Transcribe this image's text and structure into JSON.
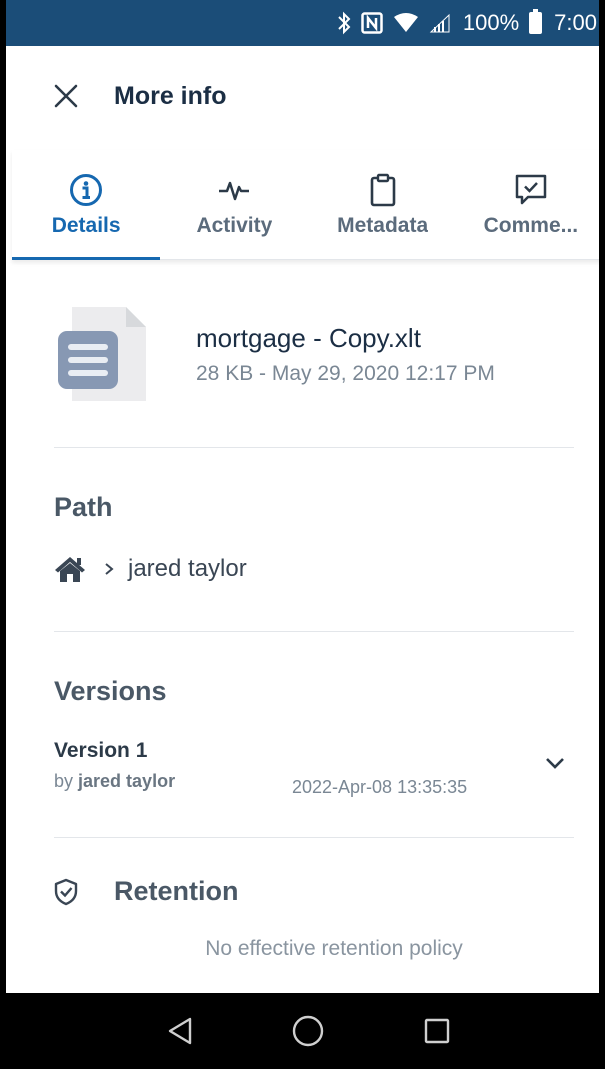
{
  "status_bar": {
    "battery": "100%",
    "time": "7:00",
    "icons": [
      "bluetooth-icon",
      "nfc-icon",
      "wifi-icon",
      "signal-icon",
      "battery-icon"
    ]
  },
  "header": {
    "title": "More info",
    "close_icon": "close-icon"
  },
  "tabs": [
    {
      "label": "Details",
      "icon": "info-icon",
      "active": true
    },
    {
      "label": "Activity",
      "icon": "activity-icon",
      "active": false
    },
    {
      "label": "Metadata",
      "icon": "clipboard-icon",
      "active": false
    },
    {
      "label": "Comme...",
      "icon": "comment-check-icon",
      "active": false
    }
  ],
  "file": {
    "name": "mortgage - Copy.xlt",
    "meta": "28 KB - May 29, 2020 12:17 PM",
    "icon": "document-icon"
  },
  "path": {
    "title": "Path",
    "folder": "jared taylor"
  },
  "versions": {
    "title": "Versions",
    "items": [
      {
        "name": "Version 1",
        "by_prefix": "by",
        "author": "jared taylor",
        "date": "2022-Apr-08 13:35:35"
      }
    ]
  },
  "retention": {
    "title": "Retention",
    "message": "No effective retention policy"
  },
  "colors": {
    "status_bar": "#1b4d78",
    "accent": "#1668b0",
    "text_dark": "#1b2e44",
    "text_muted": "#7a8794"
  }
}
